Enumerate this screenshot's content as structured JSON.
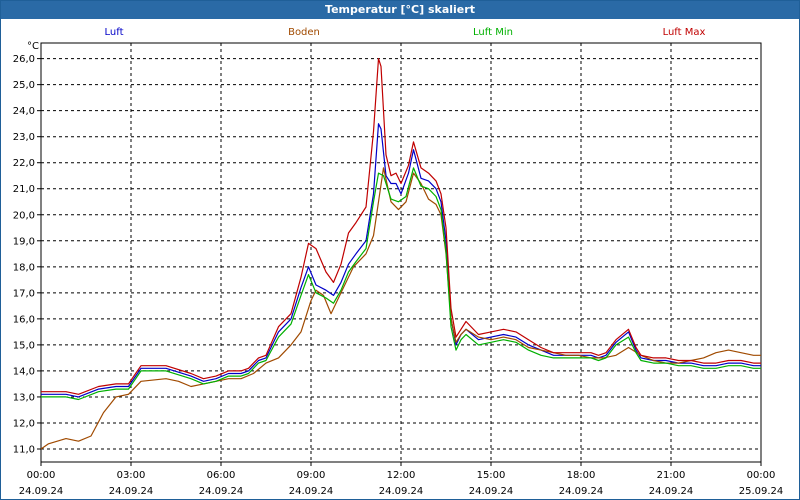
{
  "window": {
    "title": "Temperatur [°C] skaliert"
  },
  "colors": {
    "titlebar": "#2a6aa6",
    "luft": "#0000c8",
    "boden": "#a04a00",
    "luft_min": "#00b000",
    "luft_max": "#c00000",
    "grid": "#000000"
  },
  "chart_data": {
    "type": "line",
    "title": "Temperatur [°C] skaliert",
    "ylabel": "°C",
    "xlabel": "",
    "ylim": [
      10.5,
      26.6
    ],
    "xlim": [
      0,
      24
    ],
    "grid": true,
    "legend_position": "top",
    "yticks": [
      "11,0",
      "12,0",
      "13,0",
      "14,0",
      "15,0",
      "16,0",
      "17,0",
      "18,0",
      "19,0",
      "20,0",
      "21,0",
      "22,0",
      "23,0",
      "24,0",
      "25,0",
      "26,0"
    ],
    "xticks": [
      {
        "time": "00:00",
        "date": "24.09.24"
      },
      {
        "time": "03:00",
        "date": "24.09.24"
      },
      {
        "time": "06:00",
        "date": "24.09.24"
      },
      {
        "time": "09:00",
        "date": "24.09.24"
      },
      {
        "time": "12:00",
        "date": "24.09.24"
      },
      {
        "time": "15:00",
        "date": "24.09.24"
      },
      {
        "time": "18:00",
        "date": "24.09.24"
      },
      {
        "time": "21:00",
        "date": "24.09.24"
      },
      {
        "time": "00:00",
        "date": "25.09.24"
      }
    ],
    "series": [
      {
        "name": "Luft",
        "color": "#0000c8",
        "points": [
          [
            0,
            13.1
          ],
          [
            1,
            13.1
          ],
          [
            1.5,
            13.0
          ],
          [
            2.3,
            13.3
          ],
          [
            3,
            13.4
          ],
          [
            3.5,
            13.4
          ],
          [
            4,
            14.1
          ],
          [
            5,
            14.1
          ],
          [
            6,
            13.8
          ],
          [
            6.5,
            13.6
          ],
          [
            7,
            13.7
          ],
          [
            7.5,
            13.9
          ],
          [
            8,
            13.9
          ],
          [
            8.3,
            14.0
          ],
          [
            8.7,
            14.4
          ],
          [
            9,
            14.5
          ],
          [
            9.5,
            15.5
          ],
          [
            10,
            16.0
          ],
          [
            10.4,
            17.2
          ],
          [
            10.7,
            18.0
          ],
          [
            11,
            17.3
          ],
          [
            11.4,
            17.1
          ],
          [
            11.7,
            16.9
          ],
          [
            12,
            17.4
          ],
          [
            12.3,
            18.1
          ],
          [
            12.6,
            18.5
          ],
          [
            13,
            19.0
          ],
          [
            13.3,
            20.8
          ],
          [
            13.5,
            23.5
          ],
          [
            13.6,
            23.3
          ],
          [
            13.8,
            21.5
          ],
          [
            14,
            21.2
          ],
          [
            14.2,
            21.2
          ],
          [
            14.4,
            20.8
          ],
          [
            14.7,
            21.6
          ],
          [
            14.9,
            22.5
          ],
          [
            15.2,
            21.4
          ],
          [
            15.5,
            21.3
          ],
          [
            15.8,
            21.0
          ],
          [
            16,
            20.5
          ],
          [
            16.2,
            19.0
          ],
          [
            16.4,
            16.0
          ],
          [
            16.6,
            15.0
          ],
          [
            16.8,
            15.4
          ],
          [
            17,
            15.6
          ],
          [
            17.5,
            15.2
          ],
          [
            18,
            15.3
          ],
          [
            18.5,
            15.4
          ],
          [
            19,
            15.3
          ],
          [
            19.5,
            15.0
          ],
          [
            20,
            14.8
          ],
          [
            20.5,
            14.6
          ],
          [
            21,
            14.6
          ],
          [
            21.5,
            14.6
          ],
          [
            22,
            14.6
          ],
          [
            22.3,
            14.5
          ],
          [
            22.6,
            14.6
          ],
          [
            23,
            15.1
          ],
          [
            23.5,
            15.5
          ],
          [
            23.8,
            14.8
          ],
          [
            24,
            14.5
          ],
          [
            24.5,
            14.4
          ],
          [
            25,
            14.4
          ],
          [
            25.5,
            14.3
          ],
          [
            26,
            14.3
          ],
          [
            26.5,
            14.2
          ],
          [
            27,
            14.2
          ],
          [
            27.5,
            14.3
          ],
          [
            28,
            14.3
          ],
          [
            28.5,
            14.2
          ],
          [
            28.8,
            14.2
          ]
        ]
      },
      {
        "name": "Boden",
        "color": "#a04a00",
        "points": [
          [
            0,
            11.0
          ],
          [
            0.3,
            11.2
          ],
          [
            1,
            11.4
          ],
          [
            1.5,
            11.3
          ],
          [
            2,
            11.5
          ],
          [
            2.5,
            12.4
          ],
          [
            3,
            13.0
          ],
          [
            3.5,
            13.1
          ],
          [
            4,
            13.6
          ],
          [
            5,
            13.7
          ],
          [
            5.5,
            13.6
          ],
          [
            6,
            13.4
          ],
          [
            6.5,
            13.5
          ],
          [
            7,
            13.6
          ],
          [
            7.5,
            13.7
          ],
          [
            8,
            13.7
          ],
          [
            8.5,
            13.9
          ],
          [
            9,
            14.3
          ],
          [
            9.5,
            14.5
          ],
          [
            10,
            15.0
          ],
          [
            10.4,
            15.5
          ],
          [
            10.8,
            16.7
          ],
          [
            11,
            17.1
          ],
          [
            11.3,
            16.9
          ],
          [
            11.6,
            16.2
          ],
          [
            12,
            17.0
          ],
          [
            12.5,
            18.0
          ],
          [
            13,
            18.5
          ],
          [
            13.3,
            19.2
          ],
          [
            13.5,
            20.5
          ],
          [
            13.7,
            21.8
          ],
          [
            14,
            20.5
          ],
          [
            14.3,
            20.2
          ],
          [
            14.6,
            20.5
          ],
          [
            14.9,
            21.6
          ],
          [
            15.2,
            21.2
          ],
          [
            15.5,
            20.6
          ],
          [
            15.8,
            20.4
          ],
          [
            16,
            20.0
          ],
          [
            16.2,
            18.5
          ],
          [
            16.4,
            16.0
          ],
          [
            16.6,
            15.1
          ],
          [
            16.8,
            15.4
          ],
          [
            17,
            15.6
          ],
          [
            17.5,
            15.3
          ],
          [
            18,
            15.2
          ],
          [
            18.5,
            15.3
          ],
          [
            19,
            15.2
          ],
          [
            19.5,
            14.9
          ],
          [
            20,
            14.8
          ],
          [
            20.5,
            14.7
          ],
          [
            21,
            14.6
          ],
          [
            21.5,
            14.6
          ],
          [
            22,
            14.5
          ],
          [
            22.5,
            14.5
          ],
          [
            23,
            14.6
          ],
          [
            23.5,
            14.9
          ],
          [
            24,
            14.6
          ],
          [
            24.5,
            14.4
          ],
          [
            25,
            14.3
          ],
          [
            25.5,
            14.3
          ],
          [
            26,
            14.4
          ],
          [
            26.5,
            14.5
          ],
          [
            27,
            14.7
          ],
          [
            27.5,
            14.8
          ],
          [
            28,
            14.7
          ],
          [
            28.5,
            14.6
          ],
          [
            28.8,
            14.6
          ]
        ]
      },
      {
        "name": "Luft Min",
        "color": "#00b000",
        "points": [
          [
            0,
            13.0
          ],
          [
            1,
            13.0
          ],
          [
            1.5,
            12.9
          ],
          [
            2.3,
            13.2
          ],
          [
            3,
            13.3
          ],
          [
            3.5,
            13.3
          ],
          [
            4,
            14.0
          ],
          [
            5,
            14.0
          ],
          [
            6,
            13.7
          ],
          [
            6.5,
            13.5
          ],
          [
            7,
            13.6
          ],
          [
            7.5,
            13.8
          ],
          [
            8,
            13.8
          ],
          [
            8.3,
            13.9
          ],
          [
            8.7,
            14.3
          ],
          [
            9,
            14.4
          ],
          [
            9.5,
            15.3
          ],
          [
            10,
            15.8
          ],
          [
            10.4,
            16.9
          ],
          [
            10.7,
            17.7
          ],
          [
            11,
            17.0
          ],
          [
            11.4,
            16.8
          ],
          [
            11.7,
            16.6
          ],
          [
            12,
            17.1
          ],
          [
            12.3,
            17.8
          ],
          [
            12.6,
            18.2
          ],
          [
            13,
            18.7
          ],
          [
            13.3,
            20.5
          ],
          [
            13.5,
            21.6
          ],
          [
            13.7,
            21.5
          ],
          [
            14,
            20.6
          ],
          [
            14.3,
            20.5
          ],
          [
            14.6,
            20.7
          ],
          [
            14.9,
            21.8
          ],
          [
            15.2,
            21.1
          ],
          [
            15.5,
            21.0
          ],
          [
            15.8,
            20.7
          ],
          [
            16,
            20.2
          ],
          [
            16.2,
            18.6
          ],
          [
            16.4,
            15.7
          ],
          [
            16.6,
            14.8
          ],
          [
            16.8,
            15.2
          ],
          [
            17,
            15.4
          ],
          [
            17.5,
            15.0
          ],
          [
            18,
            15.1
          ],
          [
            18.5,
            15.2
          ],
          [
            19,
            15.1
          ],
          [
            19.5,
            14.8
          ],
          [
            20,
            14.6
          ],
          [
            20.5,
            14.5
          ],
          [
            21,
            14.5
          ],
          [
            21.5,
            14.5
          ],
          [
            22,
            14.5
          ],
          [
            22.3,
            14.4
          ],
          [
            22.6,
            14.5
          ],
          [
            23,
            15.0
          ],
          [
            23.5,
            15.3
          ],
          [
            23.8,
            14.7
          ],
          [
            24,
            14.4
          ],
          [
            24.5,
            14.3
          ],
          [
            25,
            14.3
          ],
          [
            25.5,
            14.2
          ],
          [
            26,
            14.2
          ],
          [
            26.5,
            14.1
          ],
          [
            27,
            14.1
          ],
          [
            27.5,
            14.2
          ],
          [
            28,
            14.2
          ],
          [
            28.5,
            14.1
          ],
          [
            28.8,
            14.1
          ]
        ]
      },
      {
        "name": "Luft Max",
        "color": "#c00000",
        "points": [
          [
            0,
            13.2
          ],
          [
            1,
            13.2
          ],
          [
            1.5,
            13.1
          ],
          [
            2.3,
            13.4
          ],
          [
            3,
            13.5
          ],
          [
            3.5,
            13.5
          ],
          [
            4,
            14.2
          ],
          [
            5,
            14.2
          ],
          [
            6,
            13.9
          ],
          [
            6.5,
            13.7
          ],
          [
            7,
            13.8
          ],
          [
            7.5,
            14.0
          ],
          [
            8,
            14.0
          ],
          [
            8.3,
            14.1
          ],
          [
            8.7,
            14.5
          ],
          [
            9,
            14.6
          ],
          [
            9.5,
            15.7
          ],
          [
            10,
            16.2
          ],
          [
            10.4,
            17.6
          ],
          [
            10.7,
            18.9
          ],
          [
            11,
            18.7
          ],
          [
            11.4,
            17.8
          ],
          [
            11.7,
            17.4
          ],
          [
            12,
            18.1
          ],
          [
            12.3,
            19.3
          ],
          [
            12.6,
            19.7
          ],
          [
            13,
            20.3
          ],
          [
            13.3,
            23.2
          ],
          [
            13.5,
            26.0
          ],
          [
            13.6,
            25.7
          ],
          [
            13.8,
            22.3
          ],
          [
            14,
            21.5
          ],
          [
            14.2,
            21.6
          ],
          [
            14.4,
            21.2
          ],
          [
            14.7,
            21.9
          ],
          [
            14.9,
            22.8
          ],
          [
            15.2,
            21.8
          ],
          [
            15.5,
            21.6
          ],
          [
            15.8,
            21.3
          ],
          [
            16,
            20.8
          ],
          [
            16.2,
            19.5
          ],
          [
            16.4,
            16.4
          ],
          [
            16.6,
            15.3
          ],
          [
            16.8,
            15.6
          ],
          [
            17,
            15.9
          ],
          [
            17.5,
            15.4
          ],
          [
            18,
            15.5
          ],
          [
            18.5,
            15.6
          ],
          [
            19,
            15.5
          ],
          [
            19.5,
            15.2
          ],
          [
            20,
            14.9
          ],
          [
            20.5,
            14.7
          ],
          [
            21,
            14.7
          ],
          [
            21.5,
            14.7
          ],
          [
            22,
            14.7
          ],
          [
            22.3,
            14.6
          ],
          [
            22.6,
            14.7
          ],
          [
            23,
            15.2
          ],
          [
            23.5,
            15.6
          ],
          [
            23.8,
            14.9
          ],
          [
            24,
            14.6
          ],
          [
            24.5,
            14.5
          ],
          [
            25,
            14.5
          ],
          [
            25.5,
            14.4
          ],
          [
            26,
            14.4
          ],
          [
            26.5,
            14.3
          ],
          [
            27,
            14.3
          ],
          [
            27.5,
            14.4
          ],
          [
            28,
            14.4
          ],
          [
            28.5,
            14.3
          ],
          [
            28.8,
            14.3
          ]
        ]
      }
    ]
  }
}
